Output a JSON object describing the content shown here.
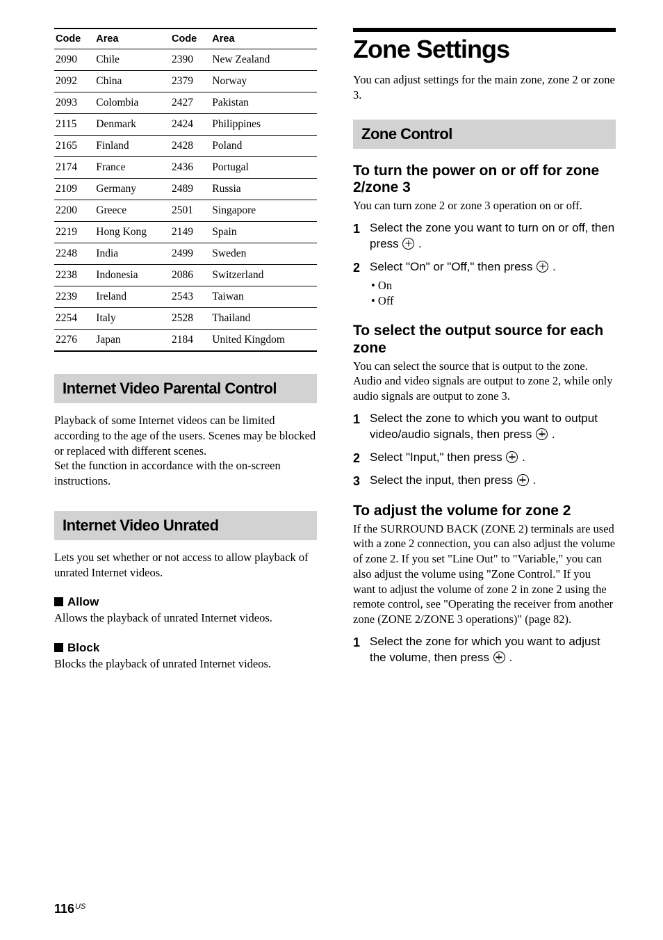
{
  "table": {
    "headers": [
      "Code",
      "Area",
      "Code",
      "Area"
    ],
    "rows": [
      [
        "2090",
        "Chile",
        "2390",
        "New Zealand"
      ],
      [
        "2092",
        "China",
        "2379",
        "Norway"
      ],
      [
        "2093",
        "Colombia",
        "2427",
        "Pakistan"
      ],
      [
        "2115",
        "Denmark",
        "2424",
        "Philippines"
      ],
      [
        "2165",
        "Finland",
        "2428",
        "Poland"
      ],
      [
        "2174",
        "France",
        "2436",
        "Portugal"
      ],
      [
        "2109",
        "Germany",
        "2489",
        "Russia"
      ],
      [
        "2200",
        "Greece",
        "2501",
        "Singapore"
      ],
      [
        "2219",
        "Hong Kong",
        "2149",
        "Spain"
      ],
      [
        "2248",
        "India",
        "2499",
        "Sweden"
      ],
      [
        "2238",
        "Indonesia",
        "2086",
        "Switzerland"
      ],
      [
        "2239",
        "Ireland",
        "2543",
        "Taiwan"
      ],
      [
        "2254",
        "Italy",
        "2528",
        "Thailand"
      ],
      [
        "2276",
        "Japan",
        "2184",
        "United Kingdom"
      ]
    ]
  },
  "left": {
    "section1": {
      "title": "Internet Video Parental Control",
      "body": "Playback of some Internet videos can be limited according to the age of the users. Scenes may be blocked or replaced with different scenes.\nSet the function in accordance with the on-screen instructions."
    },
    "section2": {
      "title": "Internet Video Unrated",
      "body": "Lets you set whether or not access to allow playback of unrated Internet videos.",
      "allow": {
        "title": "Allow",
        "body": "Allows the playback of unrated Internet videos."
      },
      "block": {
        "title": "Block",
        "body": "Blocks the playback of unrated Internet videos."
      }
    }
  },
  "right": {
    "main_title": "Zone Settings",
    "intro": "You can adjust settings for the main zone, zone 2 or zone 3.",
    "section_bar": "Zone Control",
    "task1": {
      "title": "To turn the power on or off for zone 2/zone 3",
      "body": "You can turn zone 2 or zone 3 operation on or off.",
      "step1": "Select the zone you want to turn on or off, then press ",
      "step2": "Select \"On\" or \"Off,\" then press ",
      "opts": [
        "On",
        "Off"
      ]
    },
    "task2": {
      "title": "To select the output source for each zone",
      "body": "You can select the source that is output to the zone. Audio and video signals are output to zone 2, while only audio signals are output to zone 3.",
      "step1": "Select the zone to which you want to output video/audio signals, then press ",
      "step2": "Select \"Input,\" then press ",
      "step3": "Select the input, then press "
    },
    "task3": {
      "title": "To adjust the volume for zone 2",
      "body": "If the SURROUND BACK (ZONE 2) terminals are used with a zone 2 connection, you can also adjust the volume of zone 2. If you set \"Line Out\" to \"Variable,\" you can also adjust the volume using \"Zone Control.\" If you want to adjust the volume of zone 2 in zone 2 using the remote control, see \"Operating the receiver from another zone (ZONE 2/ZONE 3 operations)\" (page 82).",
      "step1": "Select the zone for which you want to adjust the volume, then press "
    }
  },
  "page": {
    "number": "116",
    "region": "US"
  }
}
